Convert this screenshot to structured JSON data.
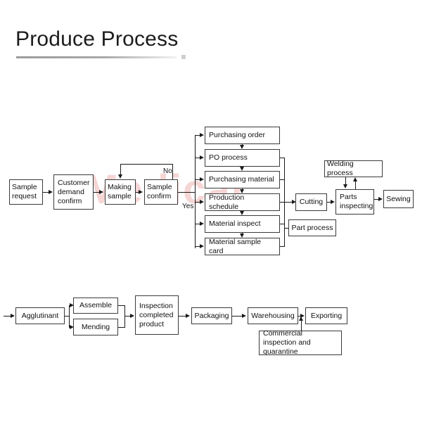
{
  "page": {
    "title": "Produce Process",
    "watermark_text": "Medical"
  },
  "colors": {
    "background": "#ffffff",
    "box_border": "#3a3a3a",
    "connector": "#1a1a1a",
    "text": "#111111",
    "title_rule_start": "#9b9b9b",
    "watermark": "#f6d5d5"
  },
  "diagram": {
    "type": "flowchart",
    "sample_stage": {
      "nodes": [
        {
          "id": "sample-request",
          "label": "Sample request"
        },
        {
          "id": "customer-demand-confirm",
          "label": "Customer demand confirm"
        },
        {
          "id": "making-sample",
          "label": "Making sample"
        },
        {
          "id": "sample-confirm",
          "label": "Sample confirm"
        }
      ],
      "edge_labels": {
        "no": "No",
        "yes": "Yes"
      }
    },
    "purchasing_stage": {
      "nodes": [
        {
          "id": "purchasing-order",
          "label": "Purchasing  order"
        },
        {
          "id": "po-process",
          "label": "PO process"
        },
        {
          "id": "purchasing-material",
          "label": "Purchasing material"
        },
        {
          "id": "production-schedule",
          "label": "Production  schedule"
        },
        {
          "id": "material-inspect",
          "label": "Material inspect"
        },
        {
          "id": "material-sample-card",
          "label": "Material sample card"
        }
      ]
    },
    "production_stage": {
      "nodes": [
        {
          "id": "cutting",
          "label": "Cutting"
        },
        {
          "id": "part-process",
          "label": "Part process"
        },
        {
          "id": "welding-process",
          "label": "Welding process"
        },
        {
          "id": "parts-inspecting",
          "label": "Parts inspecting"
        },
        {
          "id": "sewing",
          "label": "Sewing"
        }
      ]
    },
    "finishing_stage": {
      "nodes": [
        {
          "id": "agglutinant",
          "label": "Agglutinant"
        },
        {
          "id": "assemble",
          "label": "Assemble"
        },
        {
          "id": "mending",
          "label": "Mending"
        },
        {
          "id": "inspection-completed-product",
          "label": "Inspection completed product"
        },
        {
          "id": "packaging",
          "label": "Packaging"
        },
        {
          "id": "warehousing",
          "label": "Warehousing"
        },
        {
          "id": "exporting",
          "label": "Exporting"
        },
        {
          "id": "commercial-inspection-and-quarantine",
          "label": "Commercial inspection and quarantine"
        }
      ]
    }
  }
}
